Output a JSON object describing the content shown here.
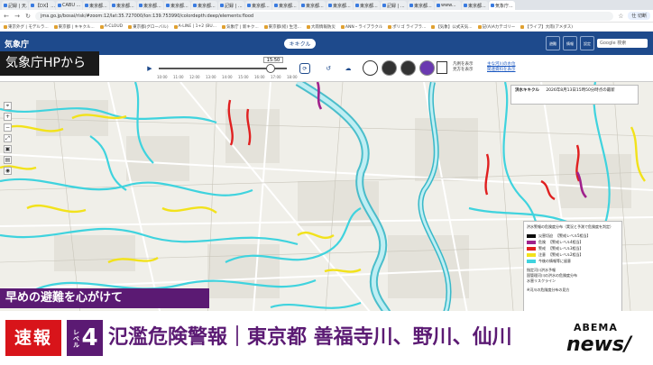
{
  "browser": {
    "tabs": [
      "記録 | 天...",
      "【DX】...",
      "CABU ...",
      "東京都...",
      "東京都...",
      "東京都...",
      "東京都...",
      "東京都...",
      "記録 | ...",
      "東京都...",
      "東京都...",
      "東京都...",
      "東京都...",
      "東京都...",
      "記録 | ...",
      "東京都...",
      "www...",
      "東京都...",
      "気象庁..."
    ],
    "url": "jma.go.jp/bosai/risk/#zoom:12/lat:35.727000/lon:139.753990/colordepth:deep/elements:flood",
    "profile_label": "仕 切断",
    "bookmarks": [
      "東京外グ | モデルラ...",
      "東京都 | キキクル...",
      "A-CLOUD",
      "東京都(グローバル)",
      "A-LINE | 1+2 (BU...",
      "気象庁 | 新キク...",
      "東京都(経) 生活...",
      "大雨情報防災",
      "ANN・ライブラクル",
      "ポリゴ ライブラ...",
      "【気象】公式天気...",
      "記(A)Aカテゴリー",
      "【ライブ】大雨(アメダス)"
    ]
  },
  "site": {
    "logo": "気象庁",
    "title": "キキクル",
    "buttons": [
      "避難",
      "情報",
      "設定"
    ],
    "search_placeholder": "Google 検索"
  },
  "controls": {
    "time_label": "15:50",
    "ticks": [
      "10:00",
      "11:00",
      "12:00",
      "13:00",
      "14:00",
      "15:00",
      "16:00",
      "17:00",
      "18:00"
    ],
    "legend_mini": [
      "凡例を表示",
      "見方を表示"
    ],
    "links": [
      "主な河川の水位",
      "関連資料を表示"
    ]
  },
  "map": {
    "tools": [
      "⌖",
      "+",
      "−",
      "⤢",
      "▣",
      "▤",
      "◉"
    ],
    "info_title": "洪水キキクル",
    "info_time": "2026年8月13日15時50分時点の最新",
    "legend_title": "洪水警報の危険度分布（実況と予測で危険度を判定）",
    "legend_items": [
      {
        "label": "災害切迫",
        "note": "【警戒レベル5相当】",
        "color": "#0c0c0c"
      },
      {
        "label": "危険",
        "note": "【警戒レベル4相当】",
        "color": "#a0218c"
      },
      {
        "label": "警戒",
        "note": "【警戒レベル3相当】",
        "color": "#e02020"
      },
      {
        "label": "注意",
        "note": "【警戒レベル2相当】",
        "color": "#f2e21b"
      },
      {
        "label": "今後の情報等に留意",
        "note": "",
        "color": "#3fd3de"
      }
    ],
    "legend_extra": [
      "指定河川洪水予報",
      "国管理河川の洪水の危険度分布",
      "水害リスクライン"
    ],
    "legend_footer": "※河川の危険度分布の見方"
  },
  "overlays": {
    "corner_label": "気象庁HPから",
    "advisory": "早めの避難を心がけて",
    "sokuho": "速報",
    "level_word": "レベル",
    "level_number": "4",
    "headline": "氾濫危険警報｜東京都 善福寺川、野川、仙川",
    "brand_top": "ABEMA",
    "brand_bottom": "news/"
  },
  "colors": {
    "jma_blue": "#1e4a8c",
    "advisory_purple": "#5b1a73",
    "breaking_red": "#d8141a",
    "river_cyan": "#3fd3de",
    "warning_yellow": "#f2e21b",
    "danger_red": "#e02020"
  }
}
